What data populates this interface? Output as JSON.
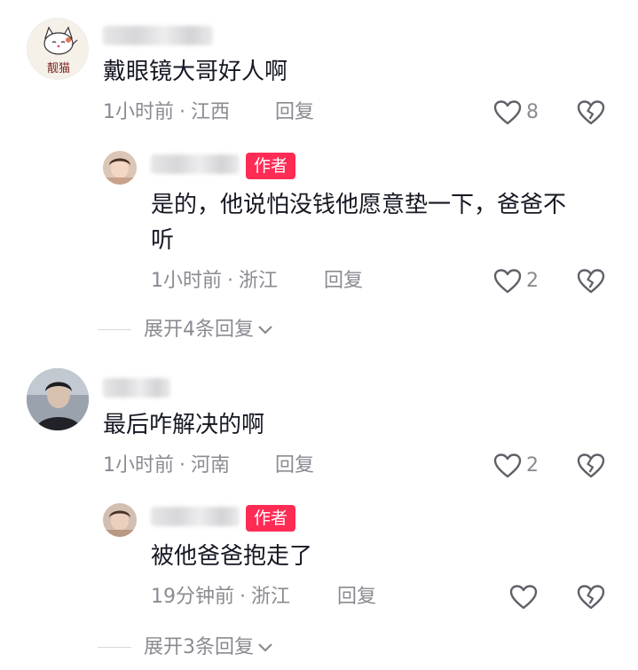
{
  "comments": [
    {
      "text": "戴眼镜大哥好人啊",
      "time": "1小时前",
      "location": "江西",
      "reply_label": "回复",
      "likes": "8",
      "avatar_text": "靓猫",
      "replies": [
        {
          "text_line1": "是的，他说怕没钱他愿意垫一下，爸爸不",
          "text_line2": "听",
          "badge": "作者",
          "time": "1小时前",
          "location": "浙江",
          "reply_label": "回复",
          "likes": "2"
        }
      ],
      "expand_label": "展开4条回复"
    },
    {
      "text": "最后咋解决的啊",
      "time": "1小时前",
      "location": "河南",
      "reply_label": "回复",
      "likes": "2",
      "replies": [
        {
          "text": "被他爸爸抱走了",
          "badge": "作者",
          "time": "19分钟前",
          "location": "浙江",
          "reply_label": "回复",
          "likes": ""
        }
      ],
      "expand_label": "展开3条回复"
    }
  ],
  "meta_separator": "·",
  "colors": {
    "badge": "#fe2c55",
    "meta": "#8a8b91",
    "text": "#161823"
  }
}
